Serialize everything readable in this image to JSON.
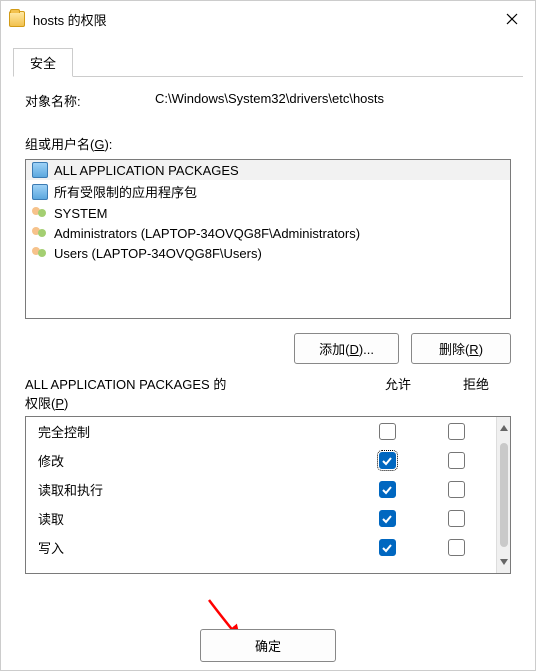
{
  "window": {
    "title": "hosts 的权限",
    "close_label": "Close"
  },
  "tab": {
    "security": "安全"
  },
  "object": {
    "label": "对象名称:",
    "value": "C:\\Windows\\System32\\drivers\\etc\\hosts"
  },
  "groups": {
    "label_prefix": "组或用户名(",
    "label_accel": "G",
    "label_suffix": "):",
    "items": [
      {
        "icon": "pkg",
        "name": "ALL APPLICATION PACKAGES",
        "selected": true
      },
      {
        "icon": "pkg",
        "name": "所有受限制的应用程序包",
        "selected": false
      },
      {
        "icon": "usr",
        "name": "SYSTEM",
        "selected": false
      },
      {
        "icon": "usr",
        "name": "Administrators (LAPTOP-34OVQG8F\\Administrators)",
        "selected": false
      },
      {
        "icon": "usr",
        "name": "Users (LAPTOP-34OVQG8F\\Users)",
        "selected": false
      }
    ]
  },
  "buttons": {
    "add_prefix": "添加(",
    "add_accel": "D",
    "add_suffix": ")...",
    "remove_prefix": "删除(",
    "remove_accel": "R",
    "remove_suffix": ")",
    "ok": "确定"
  },
  "perms": {
    "header_subject": "ALL APPLICATION PACKAGES 的",
    "header_prefix": "权限(",
    "header_accel": "P",
    "header_suffix": ")",
    "col_allow": "允许",
    "col_deny": "拒绝",
    "rows": [
      {
        "name": "完全控制",
        "allow": false,
        "deny": false,
        "focus": false
      },
      {
        "name": "修改",
        "allow": true,
        "deny": false,
        "focus": true
      },
      {
        "name": "读取和执行",
        "allow": true,
        "deny": false,
        "focus": false
      },
      {
        "name": "读取",
        "allow": true,
        "deny": false,
        "focus": false
      },
      {
        "name": "写入",
        "allow": true,
        "deny": false,
        "focus": false
      }
    ]
  }
}
